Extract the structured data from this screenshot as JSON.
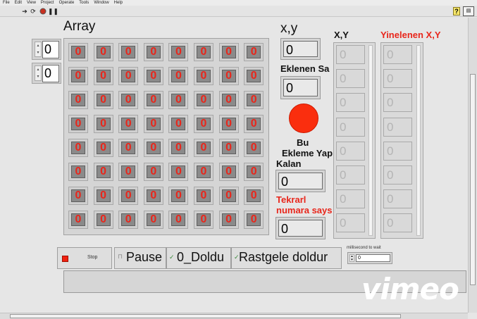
{
  "menubar": {
    "items": [
      "File",
      "Edit",
      "View",
      "Project",
      "Operate",
      "Tools",
      "Window",
      "Help"
    ]
  },
  "toolbar": {
    "icons": [
      "run-arrow-icon",
      "run-continuous-icon",
      "abort-icon",
      "pause-icon"
    ],
    "help_label": "?"
  },
  "array": {
    "label": "Array",
    "index0": "0",
    "index1": "0",
    "rows": [
      [
        "0",
        "0",
        "0",
        "0",
        "0",
        "0",
        "0",
        "0"
      ],
      [
        "0",
        "0",
        "0",
        "0",
        "0",
        "0",
        "0",
        "0"
      ],
      [
        "0",
        "0",
        "0",
        "0",
        "0",
        "0",
        "0",
        "0"
      ],
      [
        "0",
        "0",
        "0",
        "0",
        "0",
        "0",
        "0",
        "0"
      ],
      [
        "0",
        "0",
        "0",
        "0",
        "0",
        "0",
        "0",
        "0"
      ],
      [
        "0",
        "0",
        "0",
        "0",
        "0",
        "0",
        "0",
        "0"
      ],
      [
        "0",
        "0",
        "0",
        "0",
        "0",
        "0",
        "0",
        "0"
      ],
      [
        "0",
        "0",
        "0",
        "0",
        "0",
        "0",
        "0",
        "0"
      ]
    ]
  },
  "xy": {
    "label": "x,y",
    "value": "0"
  },
  "eklenen": {
    "label": "Eklenen Sa",
    "value": "0"
  },
  "led": {
    "color": "#fa2e0e"
  },
  "bu_ekleme": {
    "line1": "Bu",
    "line2": "Ekleme Yap",
    "line3": "Kalan",
    "value": "0"
  },
  "tekrarl": {
    "line1": "Tekrarl",
    "line2": "numara says",
    "value": "0"
  },
  "xy_col": {
    "label": "X,Y",
    "values": [
      "0",
      "0",
      "0",
      "0",
      "0",
      "0",
      "0",
      "0"
    ]
  },
  "yinelenen_col": {
    "label": "Yinelenen X,Y",
    "values": [
      "0",
      "0",
      "0",
      "0",
      "0",
      "0",
      "0",
      "0"
    ]
  },
  "buttons": {
    "stop": "Stop",
    "pause": "Pause",
    "doldur0": "0_Doldu",
    "rastgele": "Rastgele doldur"
  },
  "wait": {
    "label": "millisecond to wait",
    "value": "0"
  },
  "watermark": "vimeo"
}
